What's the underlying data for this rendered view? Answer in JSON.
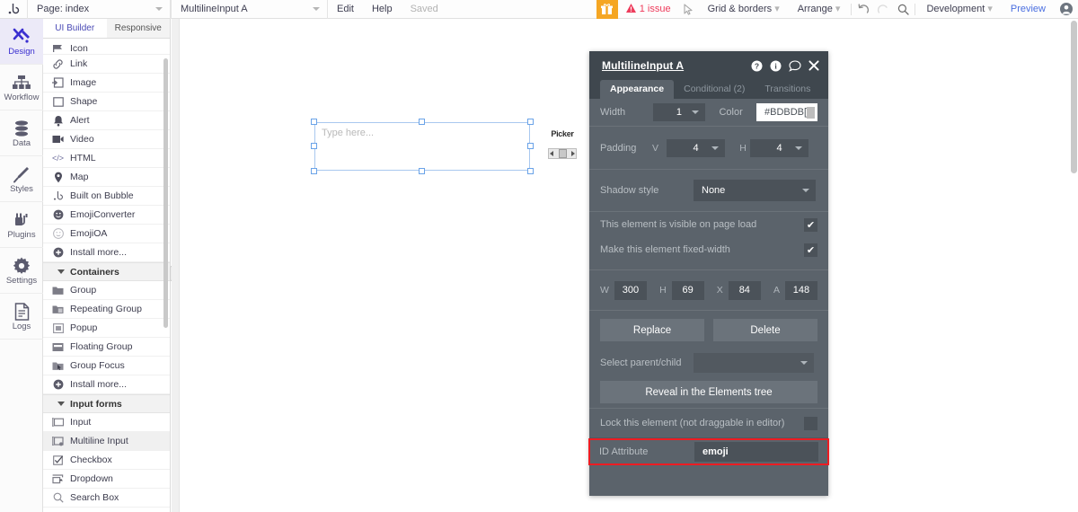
{
  "topbar": {
    "logo": "bubble-logo-icon",
    "page_selector": "Page: index",
    "element_selector": "MultilineInput A",
    "menu": [
      {
        "label": "Edit",
        "dim": false
      },
      {
        "label": "Help",
        "dim": false
      },
      {
        "label": "Saved",
        "dim": true
      }
    ],
    "gift_icon": "gift-icon",
    "issue_text": "1 issue",
    "issue_color": "#ee3b5b",
    "cursor_icon": "cursor-arrow-icon",
    "grid_borders": "Grid & borders",
    "arrange": "Arrange",
    "undo_icon": "undo-icon",
    "redo_icon": "redo-icon",
    "search_icon": "search-icon",
    "version": "Development",
    "preview": "Preview",
    "preview_color": "#4a6ee0",
    "account_icon": "user-avatar-icon"
  },
  "rail": {
    "items": [
      {
        "label": "Design",
        "icon": "design-tools-icon",
        "active": true
      },
      {
        "label": "Workflow",
        "icon": "workflow-nodes-icon",
        "active": false
      },
      {
        "label": "Data",
        "icon": "database-icon",
        "active": false
      },
      {
        "label": "Styles",
        "icon": "paintbrush-icon",
        "active": false
      },
      {
        "label": "Plugins",
        "icon": "plug-icon",
        "active": false
      },
      {
        "label": "Settings",
        "icon": "gear-icon",
        "active": false
      },
      {
        "label": "Logs",
        "icon": "document-icon",
        "active": false
      }
    ]
  },
  "palette": {
    "tabs": [
      {
        "label": "UI Builder",
        "active": true
      },
      {
        "label": "Responsive",
        "active": false
      }
    ],
    "items": [
      {
        "label": "Icon",
        "icon": "flag-icon",
        "type": "item"
      },
      {
        "label": "Link",
        "icon": "link-icon",
        "type": "item"
      },
      {
        "label": "Image",
        "icon": "image-icon",
        "type": "item"
      },
      {
        "label": "Shape",
        "icon": "shape-square-icon",
        "type": "item"
      },
      {
        "label": "Alert",
        "icon": "bell-icon",
        "type": "item"
      },
      {
        "label": "Video",
        "icon": "video-camera-icon",
        "type": "item"
      },
      {
        "label": "HTML",
        "icon": "code-tags-icon",
        "type": "item"
      },
      {
        "label": "Map",
        "icon": "map-pin-icon",
        "type": "item"
      },
      {
        "label": "Built on Bubble",
        "icon": "bubble-logo-icon",
        "type": "item"
      },
      {
        "label": "EmojiConverter",
        "icon": "emoji-filled-icon",
        "type": "item"
      },
      {
        "label": "EmojiOA",
        "icon": "emoji-outline-icon",
        "type": "item"
      },
      {
        "label": "Install more...",
        "icon": "plus-circle-icon",
        "type": "item"
      },
      {
        "label": "Containers",
        "icon": "triangle-down-icon",
        "type": "group"
      },
      {
        "label": "Group",
        "icon": "folder-icon",
        "type": "item"
      },
      {
        "label": "Repeating Group",
        "icon": "folder-repeat-icon",
        "type": "item"
      },
      {
        "label": "Popup",
        "icon": "popup-icon",
        "type": "item"
      },
      {
        "label": "Floating Group",
        "icon": "floating-group-icon",
        "type": "item"
      },
      {
        "label": "Group Focus",
        "icon": "group-focus-icon",
        "type": "item"
      },
      {
        "label": "Install more...",
        "icon": "plus-circle-icon",
        "type": "item"
      },
      {
        "label": "Input forms",
        "icon": "triangle-down-icon",
        "type": "group"
      },
      {
        "label": "Input",
        "icon": "input-field-icon",
        "type": "item"
      },
      {
        "label": "Multiline Input",
        "icon": "multiline-input-icon",
        "type": "item"
      },
      {
        "label": "Checkbox",
        "icon": "checkbox-icon",
        "type": "item"
      },
      {
        "label": "Dropdown",
        "icon": "dropdown-icon",
        "type": "item"
      },
      {
        "label": "Search Box",
        "icon": "search-icon",
        "type": "item"
      }
    ],
    "collapse_icon": "collapse-panel-icon"
  },
  "canvas": {
    "selected_element": {
      "placeholder": "Type here...",
      "name": "MultilineInput A"
    },
    "plugin_element": {
      "label": "Picker",
      "left_arrow": "chevron-left-icon",
      "right_arrow": "chevron-right-icon"
    }
  },
  "props": {
    "title": "MultilineInput A",
    "header_icons": [
      {
        "name": "help-circle-icon"
      },
      {
        "name": "info-circle-icon"
      },
      {
        "name": "comment-bubble-icon"
      },
      {
        "name": "close-icon"
      }
    ],
    "tabs": [
      {
        "label": "Appearance",
        "active": true
      },
      {
        "label": "Conditional (2)",
        "active": false
      },
      {
        "label": "Transitions",
        "active": false
      }
    ],
    "border": {
      "width_label": "Width",
      "width_value": "1",
      "color_label": "Color",
      "color_value": "#BDBDBD",
      "color_display": "#BDBDB[",
      "swatch_hex": "#bdbdbd"
    },
    "padding": {
      "label": "Padding",
      "v_label": "V",
      "v_value": "4",
      "h_label": "H",
      "h_value": "4"
    },
    "shadow": {
      "label": "Shadow style",
      "value": "None"
    },
    "checkboxes": [
      {
        "label": "This element is visible on page load",
        "checked": true,
        "mark": "✔"
      },
      {
        "label": "Make this element fixed-width",
        "checked": true,
        "mark": "✔"
      }
    ],
    "geometry": [
      {
        "key": "W",
        "value": "300"
      },
      {
        "key": "H",
        "value": "69"
      },
      {
        "key": "X",
        "value": "84"
      },
      {
        "key": "A",
        "value": "148"
      }
    ],
    "buttons": {
      "replace": "Replace",
      "delete": "Delete",
      "reveal": "Reveal in the Elements tree"
    },
    "parent_child": {
      "label": "Select parent/child",
      "value": ""
    },
    "lock": {
      "label": "Lock this element (not draggable in editor)",
      "checked": false
    },
    "id_attribute": {
      "label": "ID Attribute",
      "value": "emoji",
      "highlight_color": "#ee1c22"
    }
  }
}
